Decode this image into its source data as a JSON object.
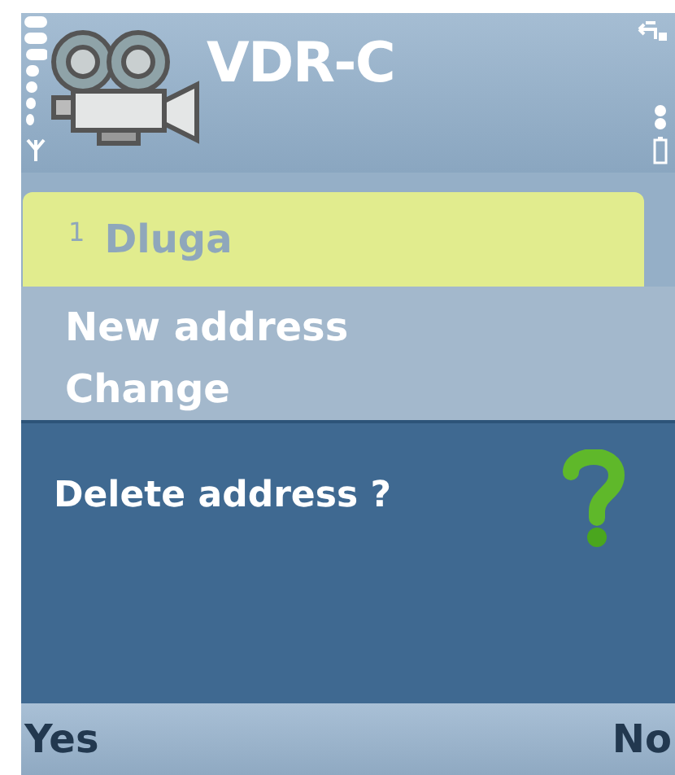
{
  "title": "VDR-C",
  "list": [
    {
      "number": "1",
      "name": "Dluga",
      "selected": true
    }
  ],
  "menu": {
    "items": [
      "New address",
      "Change"
    ]
  },
  "dialog": {
    "message": "Delete address ?"
  },
  "softkeys": {
    "left": "Yes",
    "right": "No"
  }
}
